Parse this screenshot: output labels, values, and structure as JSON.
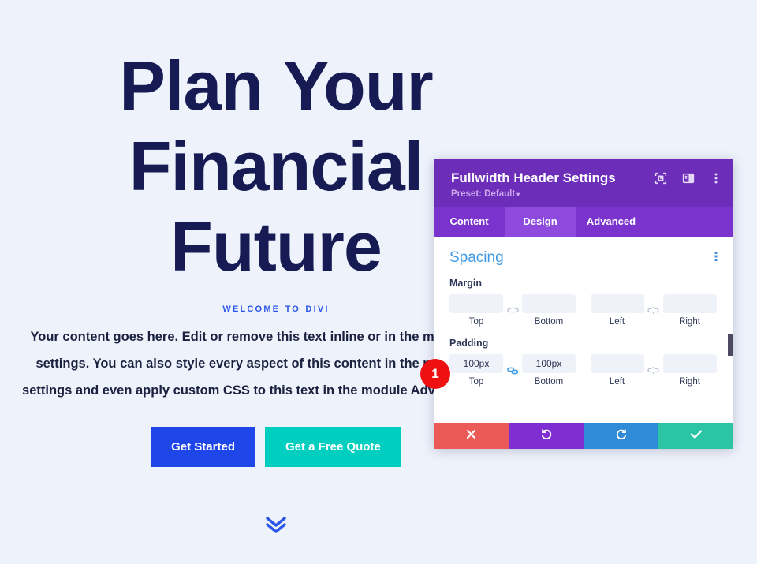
{
  "page": {
    "hero": {
      "title": "Plan Your Financial Future",
      "subtitle": "Welcome to Divi",
      "body": "Your content goes here. Edit or remove this text inline or in the module Content settings. You can also style every aspect of this content in the module Design settings and even apply custom CSS to this text in the module Advanced settings.",
      "primary_button": "Get Started",
      "secondary_button": "Get a Free Quote",
      "scroll_icon": "double-chevron-down-icon",
      "colors": {
        "background": "#eef2fb",
        "title": "#161b54",
        "subtitle": "#2b55e8",
        "primary_button": "#1f46e8",
        "secondary_button": "#00cfc0"
      }
    }
  },
  "modal": {
    "title": "Fullwidth Header Settings",
    "preset": "Preset: Default",
    "preset_caret": "▾",
    "header_icons": [
      {
        "name": "focus-target-icon"
      },
      {
        "name": "layout-panel-icon"
      },
      {
        "name": "more-vertical-icon"
      }
    ],
    "tabs": [
      {
        "label": "Content",
        "active": false
      },
      {
        "label": "Design",
        "active": true
      },
      {
        "label": "Advanced",
        "active": false
      }
    ],
    "section": {
      "title": "Spacing",
      "menu_icon": "more-vertical-icon"
    },
    "margin": {
      "label": "Margin",
      "linked_tb": false,
      "linked_lr": false,
      "fields": [
        {
          "caption": "Top",
          "value": "",
          "placeholder": ""
        },
        {
          "caption": "Bottom",
          "value": "",
          "placeholder": ""
        },
        {
          "caption": "Left",
          "value": "",
          "placeholder": ""
        },
        {
          "caption": "Right",
          "value": "",
          "placeholder": ""
        }
      ]
    },
    "padding": {
      "label": "Padding",
      "linked_tb": true,
      "linked_lr": false,
      "fields": [
        {
          "caption": "Top",
          "value": "100px",
          "placeholder": ""
        },
        {
          "caption": "Bottom",
          "value": "100px",
          "placeholder": ""
        },
        {
          "caption": "Left",
          "value": "",
          "placeholder": ""
        },
        {
          "caption": "Right",
          "value": "",
          "placeholder": ""
        }
      ]
    },
    "actions": [
      {
        "name": "cancel",
        "icon": "close-icon",
        "color": "#ec5a57"
      },
      {
        "name": "undo",
        "icon": "undo-icon",
        "color": "#7f2ed3"
      },
      {
        "name": "redo",
        "icon": "redo-icon",
        "color": "#2f8ad8"
      },
      {
        "name": "save",
        "icon": "check-icon",
        "color": "#2bc4a4"
      }
    ],
    "colors": {
      "header": "#6c2eb9",
      "tabbar": "#7a33cc",
      "tab_active": "#8e49dd",
      "section_title": "#3f9ae5",
      "link_active": "#3f9ae5"
    }
  },
  "annotation": {
    "badge_1": "1"
  }
}
